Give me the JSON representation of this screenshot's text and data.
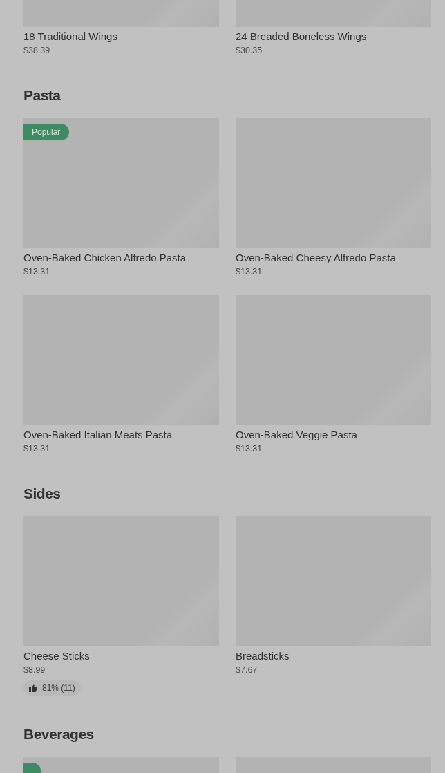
{
  "sections": [
    {
      "items": [
        {
          "name": "18 Traditional Wings",
          "price": "$38.39",
          "popular": false
        },
        {
          "name": "24 Breaded Boneless Wings",
          "price": "$30.35",
          "popular": false
        }
      ]
    },
    {
      "title": "Pasta",
      "items": [
        {
          "name": "Oven-Baked Chicken Alfredo Pasta",
          "price": "$13.31",
          "popular": true,
          "badge": "Popular"
        },
        {
          "name": "Oven-Baked Cheesy Alfredo Pasta",
          "price": "$13.31",
          "popular": false
        },
        {
          "name": "Oven-Baked Italian Meats Pasta",
          "price": "$13.31",
          "popular": false
        },
        {
          "name": "Oven-Baked Veggie Pasta",
          "price": "$13.31",
          "popular": false
        }
      ]
    },
    {
      "title": "Sides",
      "items": [
        {
          "name": "Cheese Sticks",
          "price": "$8.99",
          "popular": false,
          "rating": "81% (11)"
        },
        {
          "name": "Breadsticks",
          "price": "$7.67",
          "popular": false
        }
      ]
    },
    {
      "title": "Beverages",
      "items": [
        {
          "popular": true
        },
        {
          "popular": false
        }
      ]
    }
  ]
}
